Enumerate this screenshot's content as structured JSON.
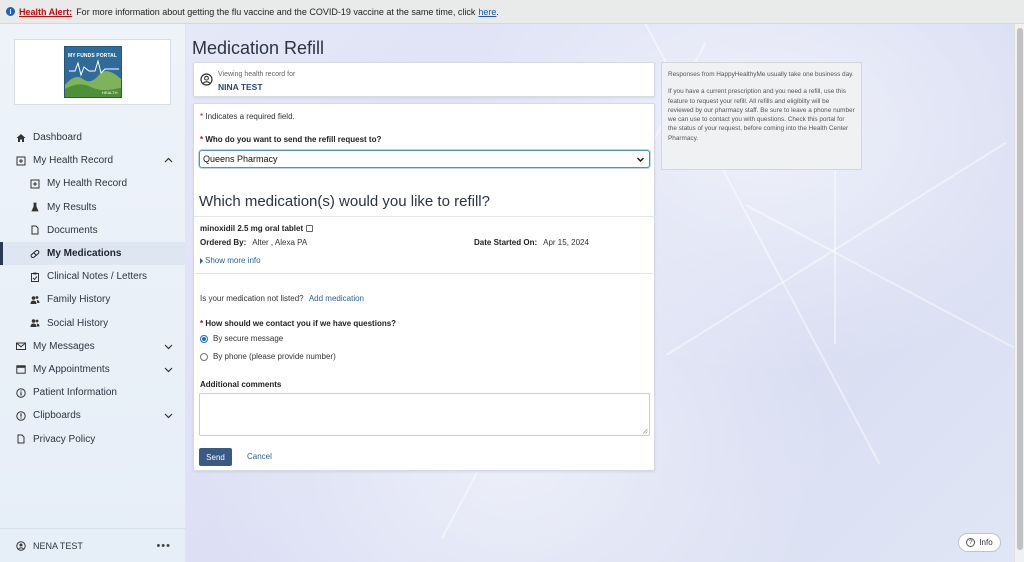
{
  "alert": {
    "label": "Health Alert:",
    "message": "For more information about getting the flu vaccine and the COVID-19 vaccine at the same time, click",
    "link": "here",
    "link_end": "."
  },
  "logo": {
    "title": "MY FUNDS PORTAL",
    "sub": "HEALTH"
  },
  "nav": {
    "dashboard": "Dashboard",
    "health_record": "My Health Record",
    "sub_health_record": "My Health Record",
    "results": "My Results",
    "documents": "Documents",
    "medications": "My Medications",
    "clinical_notes": "Clinical Notes / Letters",
    "family_history": "Family History",
    "social_history": "Social History",
    "messages": "My Messages",
    "appointments": "My Appointments",
    "patient_info": "Patient Information",
    "clipboards": "Clipboards",
    "privacy": "Privacy Policy"
  },
  "user": {
    "name": "NENA TEST",
    "more": "•••"
  },
  "page": {
    "title": "Medication Refill"
  },
  "viewing": {
    "label": "Viewing health record for",
    "name": "NINA TEST"
  },
  "form": {
    "required_star": "*",
    "required_note": "Indicates a required field.",
    "q_pharmacy": "Who do you want to send the refill request to?",
    "pharmacy_value": "Queens Pharmacy",
    "medications_heading": "Which medication(s) would you like to refill?",
    "medication": {
      "name": "minoxidil 2.5 mg oral tablet",
      "ordered_by_label": "Ordered By:",
      "ordered_by": "Alter , Alexa PA",
      "date_started_label": "Date Started On:",
      "date_started": "Apr 15, 2024",
      "show_more": "Show more info"
    },
    "not_listed": "Is your medication not listed?",
    "add_medication": "Add medication",
    "q_contact": "How should we contact you if we have questions?",
    "contact_options": [
      "By secure message",
      "By phone (please provide number)"
    ],
    "comments_label": "Additional comments",
    "send": "Send",
    "cancel": "Cancel"
  },
  "info_panel": {
    "p1": "Responses from HappyHealthyMe usually take one business day.",
    "p2": "If you have a current prescription and you need a refill, use this feature to request your refill. All refills and eligibilty will be reviewed by our pharmacy staff. Be sure to leave a phone number we can use to contact you with questions. Check this portal for the status of your request, before coming into the Health Center Pharmacy."
  },
  "info_button": "Info",
  "colors": {
    "primary": "#3a5a86",
    "link": "#2c5f9e",
    "alert_red": "#d00000"
  }
}
